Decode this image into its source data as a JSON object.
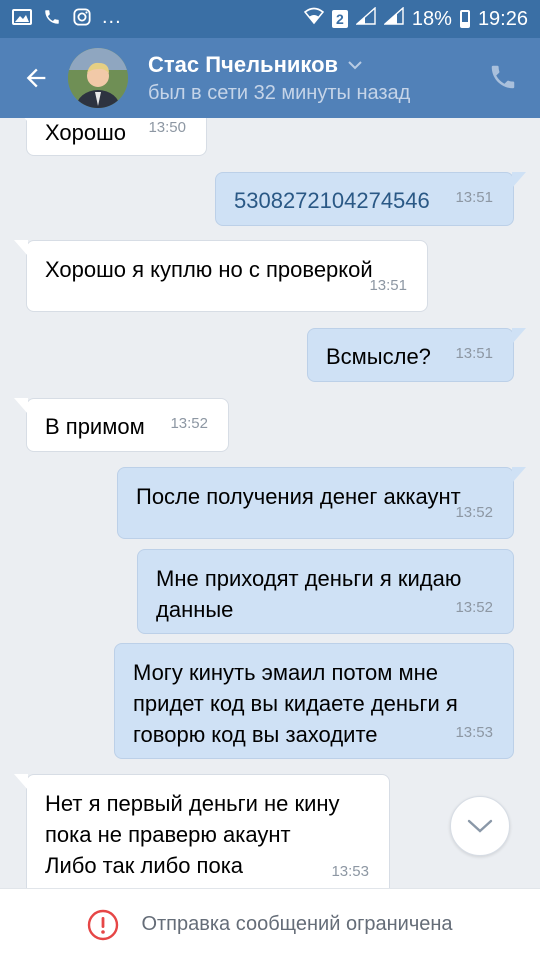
{
  "statusbar": {
    "battery": "18%",
    "time": "19:26",
    "sim": "2",
    "more": "...",
    "icons": [
      "image-icon",
      "phone-icon",
      "instagram-icon",
      "wifi-icon",
      "sim-icon",
      "signal-icon",
      "signal-icon",
      "battery-icon"
    ]
  },
  "header": {
    "name": "Стас Пчельников",
    "status": "был в сети 32 минуты назад",
    "colors": {
      "header": "#5181b8",
      "statusbar": "#3a6fa5"
    }
  },
  "messages": [
    {
      "dir": "in",
      "text": "Хорошо",
      "time": "13:50"
    },
    {
      "dir": "out",
      "text": "5308272104274546",
      "time": "13:51"
    },
    {
      "dir": "in",
      "text": "Хорошо я куплю но с проверкой",
      "time": "13:51"
    },
    {
      "dir": "out",
      "text": "Всмысле?",
      "time": "13:51"
    },
    {
      "dir": "in",
      "text": "В примом",
      "time": "13:52"
    },
    {
      "dir": "out",
      "text": "После получения денег аккаунт",
      "time": "13:52"
    },
    {
      "dir": "out",
      "text": "Мне приходят деньги я кидаю\nданные",
      "time": "13:52"
    },
    {
      "dir": "out",
      "text": "Могу кинуть эмаил потом мне\nпридет код вы кидаете деньги я\nговорю код вы заходите",
      "time": "13:53"
    },
    {
      "dir": "in",
      "text": "Нет я первый деньги не кину\nпока не праверю акаунт\nЛибо так либо пока",
      "time": "13:53"
    }
  ],
  "footer": {
    "notice": "Отправка сообщений ограничена",
    "accent": "#e64646"
  }
}
